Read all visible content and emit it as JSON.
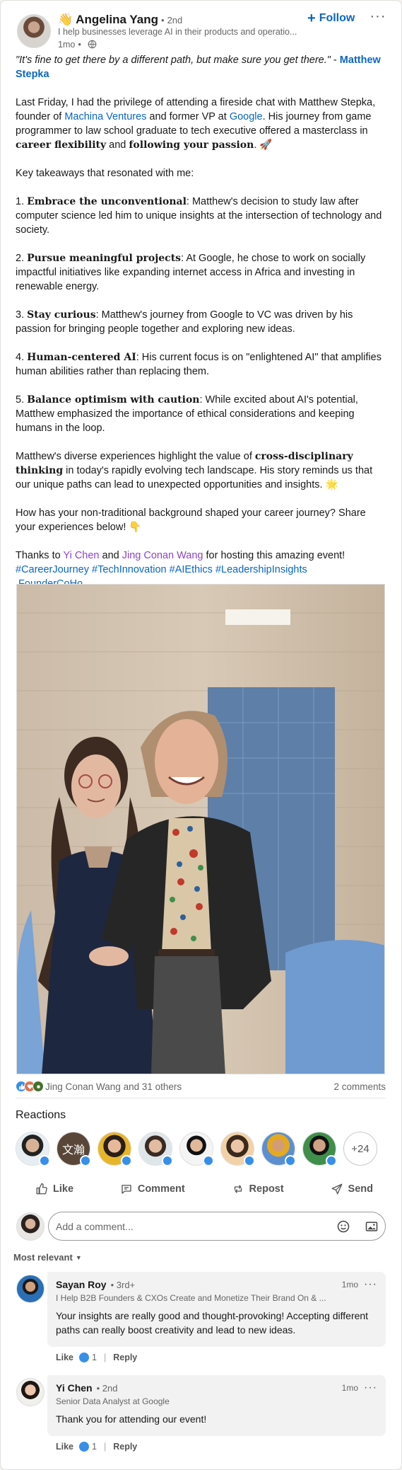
{
  "header": {
    "wave_emoji": "👋",
    "author_name": "Angelina Yang",
    "separator": "•",
    "degree": "2nd",
    "headline": "I help businesses leverage AI in their products and operatio...",
    "time": "1mo",
    "visibility_icon": "globe-icon",
    "follow_label": "Follow",
    "more_label": "···"
  },
  "post": {
    "quote_text": "\"It's fine to get there by a different path, but make sure you get there.\"",
    "quote_dash": " - ",
    "quote_author": "Matthew Stepka",
    "intro_1": "Last Friday, I had the privilege of attending a fireside chat with Matthew Stepka, founder of ",
    "intro_link_1": "Machina Ventures",
    "intro_2": " and former VP at ",
    "intro_link_2": "Google",
    "intro_3": ". His journey from game programmer to law school graduate to tech executive offered a masterclass in ",
    "intro_bold_1": "career flexibility",
    "intro_4": " and ",
    "intro_bold_2": "following your passion",
    "intro_5": ". 🚀",
    "takeaways_heading": "Key takeaways that resonated with me:",
    "takeaways": [
      {
        "num": "1. ",
        "title": "Embrace the unconventional",
        "text": ": Matthew's decision to study law after computer science led him to unique insights at the intersection of technology and society."
      },
      {
        "num": "2. ",
        "title": "Pursue meaningful projects",
        "text": ": At Google, he chose to work on socially impactful initiatives like expanding internet access in Africa and investing in renewable energy."
      },
      {
        "num": "3. ",
        "title": "Stay curious",
        "text": ": Matthew's journey from Google to VC was driven by his passion for bringing people together and exploring new ideas."
      },
      {
        "num": "4. ",
        "title": "Human-centered AI",
        "text": ": His current focus is on \"enlightened AI\" that amplifies human abilities rather than replacing them."
      },
      {
        "num": "5. ",
        "title": "Balance optimism with caution",
        "text": ": While excited about AI's potential, Matthew emphasized the importance of ethical considerations and keeping humans in the loop."
      }
    ],
    "closing_1": "Matthew's diverse experiences highlight the value of ",
    "closing_bold": "cross-disciplinary thinking",
    "closing_2": " in today's rapidly evolving tech landscape. His story reminds us that our unique paths can lead to unexpected opportunities and insights. 🌟",
    "question": "How has your non-traditional background shaped your career journey? Share your experiences below! 👇",
    "thanks_1": "Thanks to ",
    "thanks_person_1": "Yi Chen",
    "thanks_and": " and ",
    "thanks_person_2": "Jing Conan Wang",
    "thanks_2": " for hosting this amazing event!",
    "hashtags": [
      "#CareerJourney",
      "#TechInnovation",
      "#AIEthics",
      "#LeadershipInsights"
    ],
    "company_tag": "FounderCoHo"
  },
  "social": {
    "reactions_text": "Jing Conan Wang and 31 others",
    "comments_text": "2 comments",
    "reaction_icons": [
      "like-icon",
      "love-icon",
      "support-icon"
    ]
  },
  "reactions": {
    "title": "Reactions",
    "more_label": "+24",
    "reactor_count": 8,
    "reactor_glyph_2": "文瀚"
  },
  "actions": {
    "like": "Like",
    "comment": "Comment",
    "repost": "Repost",
    "send": "Send"
  },
  "composer": {
    "placeholder": "Add a comment..."
  },
  "sort": {
    "label": "Most relevant"
  },
  "comments": [
    {
      "name": "Sayan Roy",
      "degree": "• 3rd+",
      "headline": "I Help B2B Founders & CXOs Create and Monetize Their Brand On & ...",
      "time": "1mo",
      "text": "Your insights are really good and thought-provoking! Accepting different paths can really boost creativity and lead to new ideas.",
      "like_label": "Like",
      "like_count": "1",
      "reply_label": "Reply"
    },
    {
      "name": "Yi Chen",
      "degree": "• 2nd",
      "headline": "Senior Data Analyst at Google",
      "time": "1mo",
      "text": "Thank you for attending our event!",
      "like_label": "Like",
      "like_count": "1",
      "reply_label": "Reply"
    }
  ],
  "colors": {
    "link": "#0a66c2",
    "mention_purple": "#8e44c9",
    "like_blue": "#378fe9"
  }
}
